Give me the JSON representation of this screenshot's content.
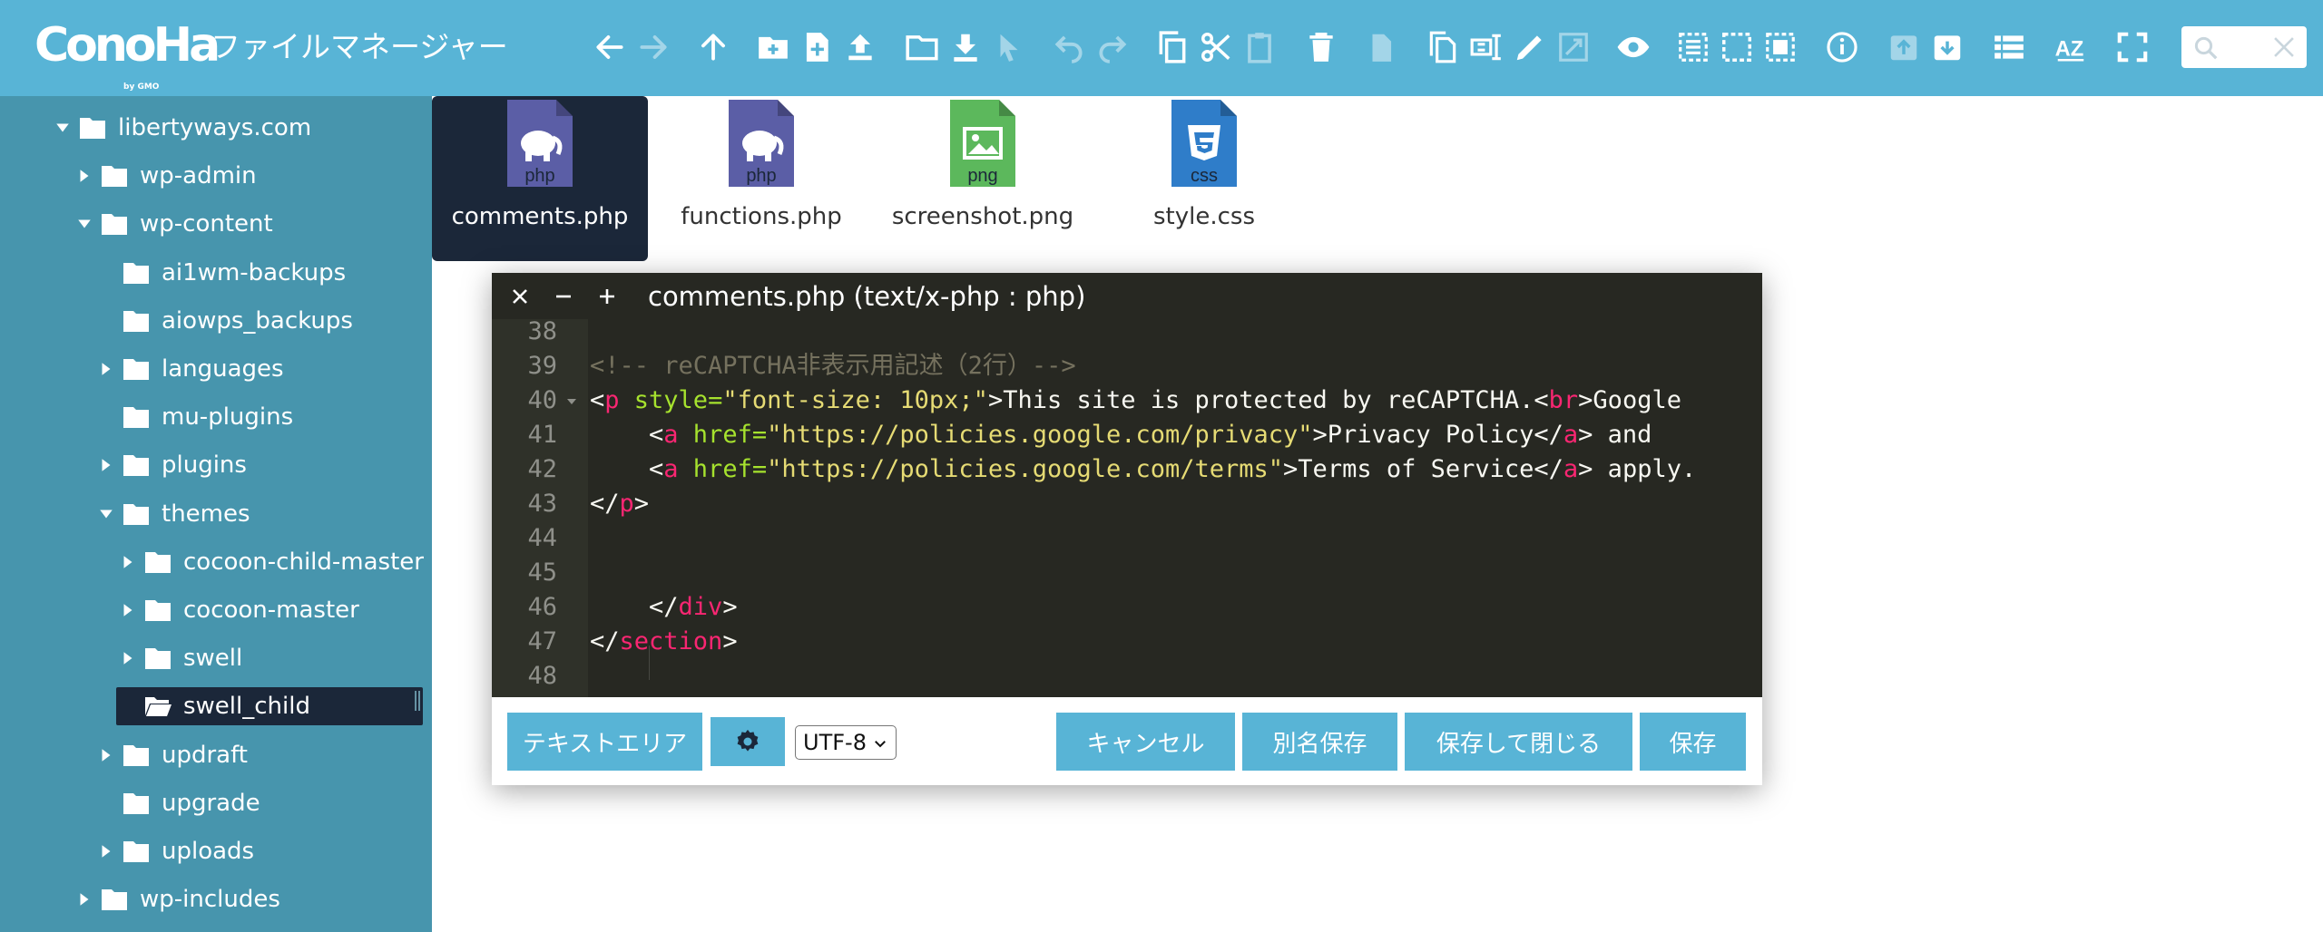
{
  "app": {
    "logo_text": "ConoHa",
    "logo_by": "by GMO",
    "title": "ファイルマネージャー"
  },
  "toolbar": {
    "icons": [
      "back-arrow-icon",
      "forward-arrow-icon",
      "up-arrow-icon",
      "new-folder-icon",
      "new-file-icon",
      "upload-icon",
      "open-folder-icon",
      "download-icon",
      "cursor-icon",
      "undo-icon",
      "redo-icon",
      "copy-icon",
      "cut-icon",
      "paste-icon",
      "trash-icon",
      "empty-icon",
      "duplicate-icon",
      "rename-icon",
      "edit-icon",
      "resize-icon",
      "preview-icon",
      "select-all-icon",
      "select-none-icon",
      "invert-selection-icon",
      "info-icon",
      "archive-icon",
      "extract-icon",
      "list-view-icon",
      "sort-icon",
      "fullscreen-icon"
    ],
    "search": {
      "placeholder": ""
    }
  },
  "sidebar": {
    "items": [
      {
        "label": "libertyways.com",
        "depth": 0,
        "arrow": "down"
      },
      {
        "label": "wp-admin",
        "depth": 1,
        "arrow": "right"
      },
      {
        "label": "wp-content",
        "depth": 1,
        "arrow": "down"
      },
      {
        "label": "ai1wm-backups",
        "depth": 2,
        "arrow": "none"
      },
      {
        "label": "aiowps_backups",
        "depth": 2,
        "arrow": "none"
      },
      {
        "label": "languages",
        "depth": 2,
        "arrow": "right"
      },
      {
        "label": "mu-plugins",
        "depth": 2,
        "arrow": "none"
      },
      {
        "label": "plugins",
        "depth": 2,
        "arrow": "right"
      },
      {
        "label": "themes",
        "depth": 2,
        "arrow": "down"
      },
      {
        "label": "cocoon-child-master",
        "depth": 3,
        "arrow": "right"
      },
      {
        "label": "cocoon-master",
        "depth": 3,
        "arrow": "right"
      },
      {
        "label": "swell",
        "depth": 3,
        "arrow": "right"
      },
      {
        "label": "swell_child",
        "depth": 3,
        "arrow": "none",
        "selected": true
      },
      {
        "label": "updraft",
        "depth": 2,
        "arrow": "right"
      },
      {
        "label": "upgrade",
        "depth": 2,
        "arrow": "none"
      },
      {
        "label": "uploads",
        "depth": 2,
        "arrow": "right"
      },
      {
        "label": "wp-includes",
        "depth": 1,
        "arrow": "right"
      }
    ]
  },
  "files": [
    {
      "name": "comments.php",
      "type": "php",
      "color": "#5b5ea6",
      "selected": true
    },
    {
      "name": "functions.php",
      "type": "php",
      "color": "#5b5ea6",
      "selected": false
    },
    {
      "name": "screenshot.png",
      "type": "png",
      "color": "#5cb85c",
      "selected": false
    },
    {
      "name": "style.css",
      "type": "css",
      "color": "#2f7dc9",
      "selected": false
    }
  ],
  "editor": {
    "title": "comments.php (text/x-php : php)",
    "line_numbers": [
      "38",
      "39",
      "40",
      "41",
      "42",
      "43",
      "44",
      "45",
      "46",
      "47",
      "48"
    ],
    "lines": [
      [],
      [
        {
          "t": "<!-- reCAPTCHA非表示用記述（2行）-->",
          "c": "com"
        }
      ],
      [
        {
          "t": "<",
          "c": "txt"
        },
        {
          "t": "p",
          "c": "tag"
        },
        {
          "t": " style=",
          "c": "attr"
        },
        {
          "t": "\"font-size: 10px;\"",
          "c": "str"
        },
        {
          "t": ">This site is protected by reCAPTCHA.<",
          "c": "txt"
        },
        {
          "t": "br",
          "c": "tag"
        },
        {
          "t": ">Google",
          "c": "txt"
        }
      ],
      [
        {
          "t": "    <",
          "c": "txt"
        },
        {
          "t": "a",
          "c": "tag"
        },
        {
          "t": " href=",
          "c": "attr"
        },
        {
          "t": "\"https://policies.google.com/privacy\"",
          "c": "str"
        },
        {
          "t": ">Privacy Policy</",
          "c": "txt"
        },
        {
          "t": "a",
          "c": "tag"
        },
        {
          "t": "> and",
          "c": "txt"
        }
      ],
      [
        {
          "t": "    <",
          "c": "txt"
        },
        {
          "t": "a",
          "c": "tag"
        },
        {
          "t": " href=",
          "c": "attr"
        },
        {
          "t": "\"https://policies.google.com/terms\"",
          "c": "str"
        },
        {
          "t": ">Terms of Service</",
          "c": "txt"
        },
        {
          "t": "a",
          "c": "tag"
        },
        {
          "t": "> apply.",
          "c": "txt"
        }
      ],
      [
        {
          "t": "</",
          "c": "txt"
        },
        {
          "t": "p",
          "c": "tag"
        },
        {
          "t": ">",
          "c": "txt"
        }
      ],
      [],
      [],
      [
        {
          "t": "    </",
          "c": "txt"
        },
        {
          "t": "div",
          "c": "tag"
        },
        {
          "t": ">",
          "c": "txt"
        }
      ],
      [
        {
          "t": "</",
          "c": "txt"
        },
        {
          "t": "section",
          "c": "tag"
        },
        {
          "t": ">",
          "c": "txt"
        }
      ],
      []
    ],
    "buttons": {
      "textarea": "テキストエリア",
      "cancel": "キャンセル",
      "save_as": "別名保存",
      "save_close": "保存して閉じる",
      "save": "保存"
    },
    "encoding": "UTF-8"
  },
  "colors": {
    "accent": "#58b4d6",
    "sidebar": "#4795ad",
    "selected": "#1b2739",
    "editor_bg": "#272822"
  }
}
